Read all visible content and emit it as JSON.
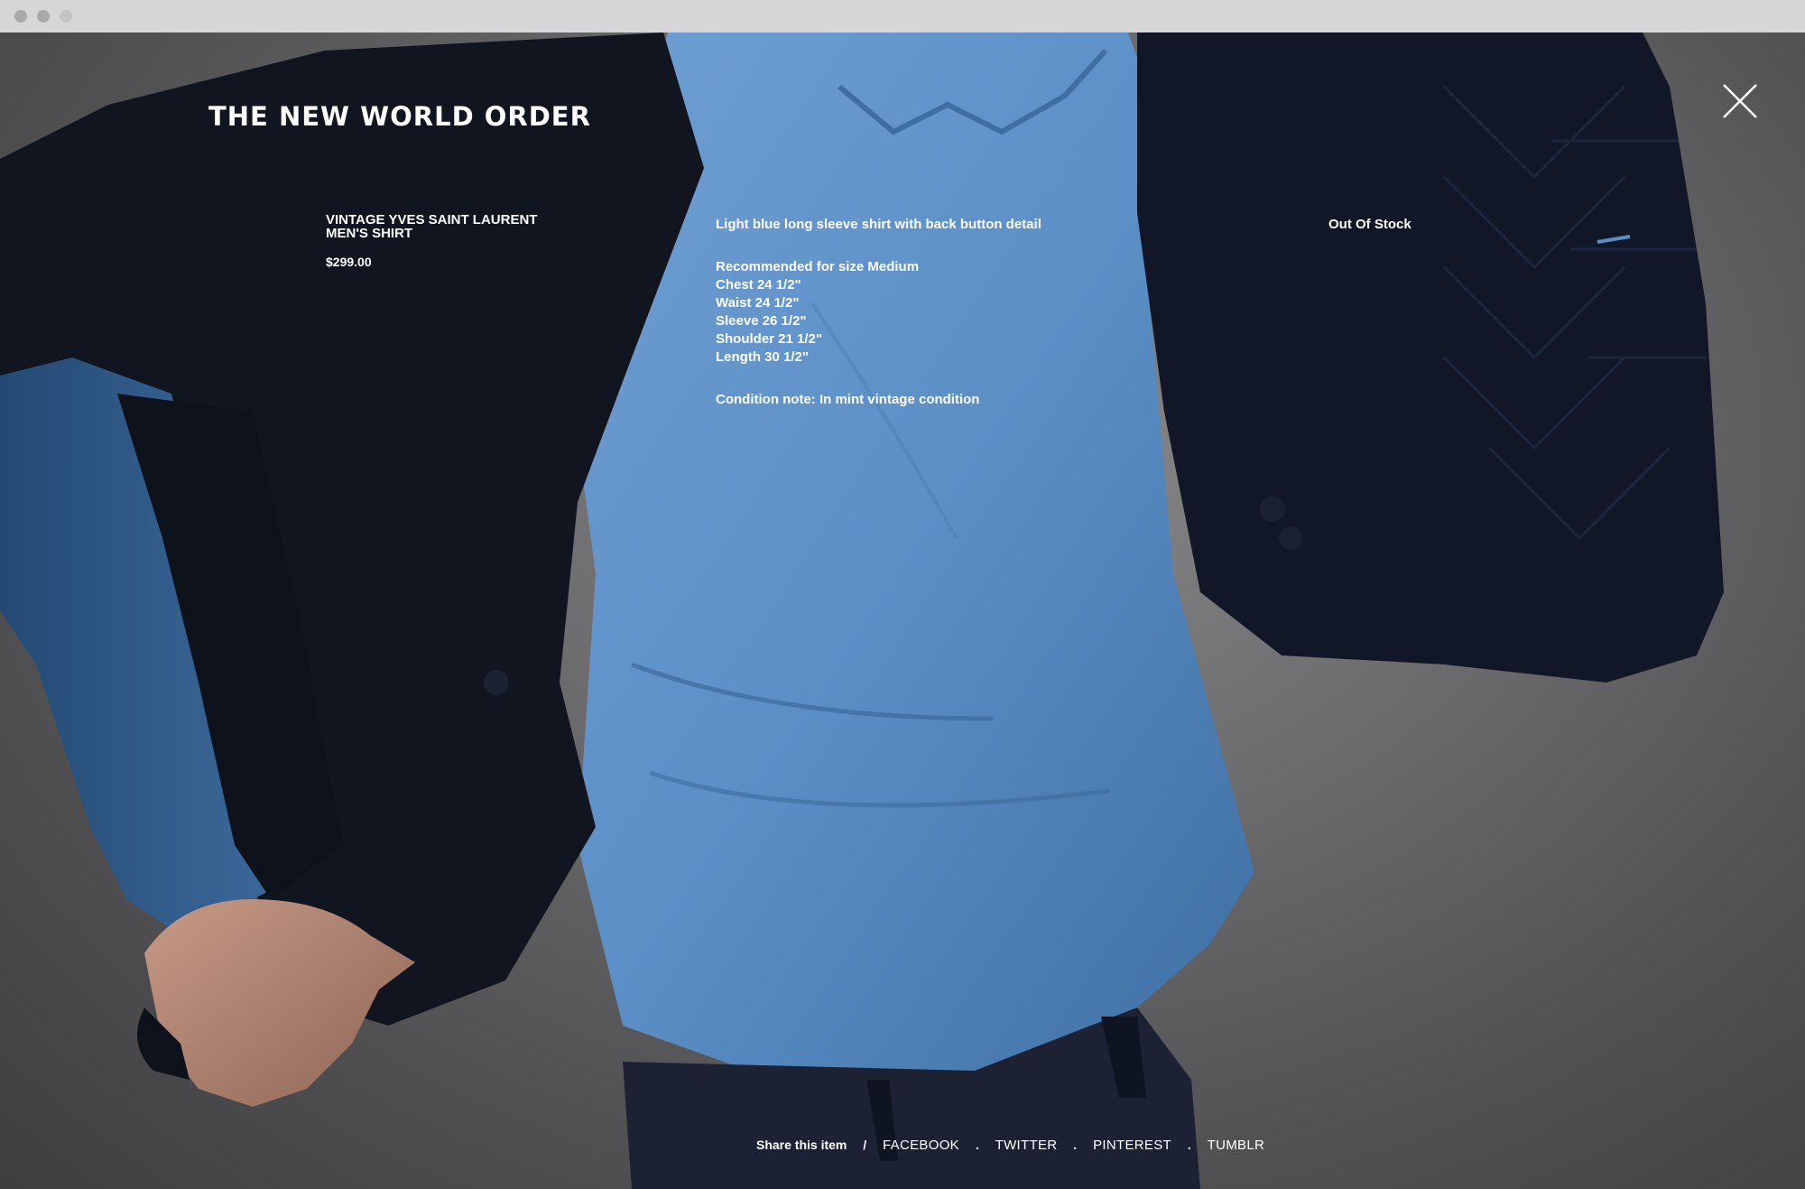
{
  "brand": {
    "title": "THE NEW WORLD ORDER"
  },
  "product": {
    "name": "VINTAGE YVES SAINT LAURENT MEN'S SHIRT",
    "price": "$299.00",
    "description": "Light blue long sleeve shirt with back button detail",
    "recommended": "Recommended for size Medium",
    "measurements": [
      "Chest 24 1/2\"",
      "Waist 24 1/2\"",
      "Sleeve 26 1/2\"",
      "Shoulder 21 1/2\"",
      "Length 30 1/2\""
    ],
    "condition": "Condition note: In mint vintage condition",
    "stock_status": "Out Of Stock"
  },
  "share": {
    "label": "Share this item",
    "separator": "/",
    "dot": ".",
    "links": [
      "FACEBOOK",
      "TWITTER",
      "PINTEREST",
      "TUMBLR"
    ]
  },
  "icons": {
    "close": "close-icon"
  },
  "colors": {
    "text": "#ffffff",
    "shirt": "#5b8fc6",
    "jacket": "#0f1420",
    "background": "#6b6b6d"
  }
}
